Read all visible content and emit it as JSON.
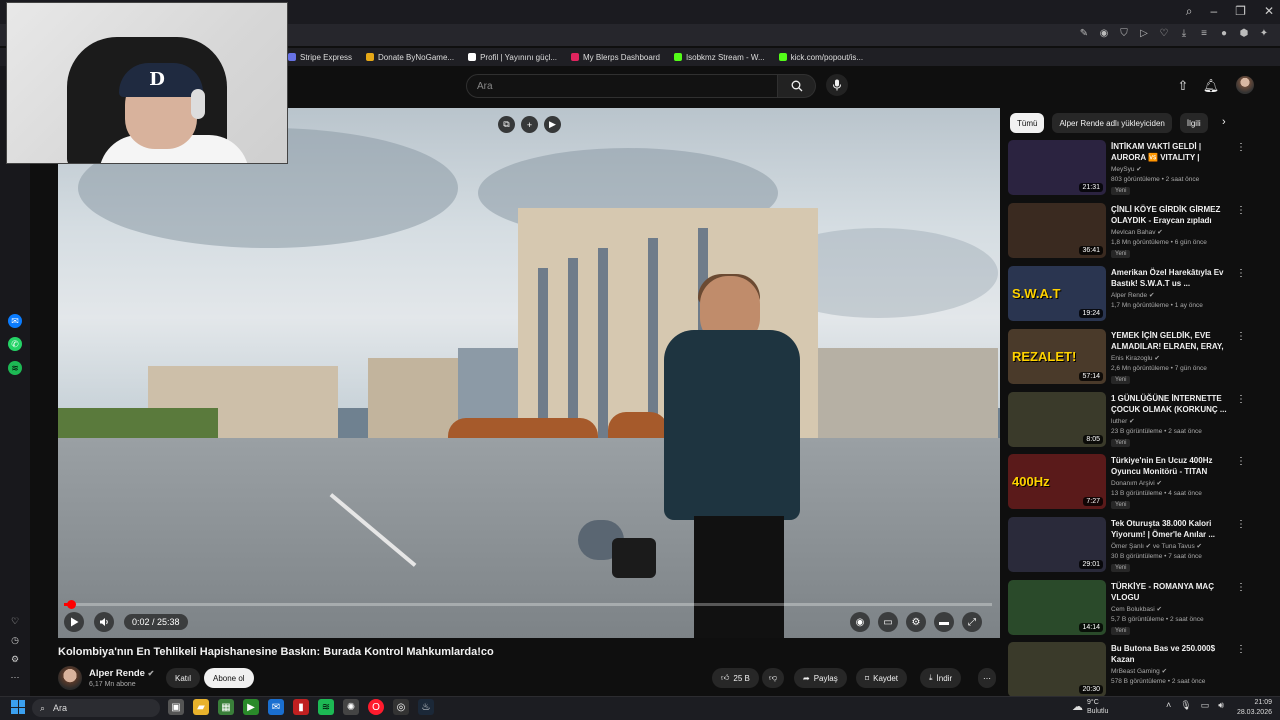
{
  "bookmarks": [
    {
      "label": "Stripe Express",
      "color": "#6772e5"
    },
    {
      "label": "Donate ByNoGame...",
      "color": "#e6a817"
    },
    {
      "label": "Profil | Yayınını güçl...",
      "color": "#ffffff"
    },
    {
      "label": "My Blerps Dashboard",
      "color": "#e0245e"
    },
    {
      "label": "Isobkmz Stream - W...",
      "color": "#53fc18"
    },
    {
      "label": "kick.com/popout/is...",
      "color": "#53fc18"
    }
  ],
  "header": {
    "search_placeholder": "Ara"
  },
  "player": {
    "time": "0:02 / 25:38",
    "progress": 0.0013
  },
  "video": {
    "title": "Kolombiya'nın En Tehlikeli Hapishanesine Baskın: Burada Kontrol Mahkumlarda!co",
    "channel": "Alper Rende",
    "subscribers": "6,17 Mn abone",
    "join_label": "Katıl",
    "subscribe_label": "Abone ol",
    "likes": "25 B",
    "share_label": "Paylaş",
    "save_label": "Kaydet",
    "download_label": "İndir"
  },
  "chips": [
    "Tümü",
    "Alper Rende adlı yükleyiciden",
    "İlgili"
  ],
  "recommendations": [
    {
      "title": "İNTİKAM VAKTİ GELDİ | AURORA 🆚 VITALITY | BLAS...",
      "channel": "MeySyu",
      "meta": "803 görüntüleme • 2 saat önce",
      "badge": "Yeni",
      "duration": "21:31",
      "thumb_color": "#2b2340"
    },
    {
      "title": "ÇİNLİ KÖYE GİRDİK GİRMEZ OLAYDIK - Eraycan zıpladı",
      "channel": "Mevlcan Bahav",
      "meta": "1,8 Mn görüntüleme • 6 gün önce",
      "badge": "Yeni",
      "duration": "36:41",
      "thumb_color": "#3a2a20"
    },
    {
      "title": "Amerikan Özel Harekâtıyla Ev Bastık! S.W.A.T us ...",
      "channel": "Alper Rende",
      "meta": "1,7 Mn görüntüleme • 1 ay önce",
      "badge": "",
      "duration": "19:24",
      "thumb_color": "#2a3550",
      "thumb_text": "S.W.A.T"
    },
    {
      "title": "YEMEK İÇİN GELDİK, EVE ALMADILAR! ELRAEN, ERAY, ...",
      "channel": "Enis Kirazoglu",
      "meta": "2,6 Mn görüntüleme • 7 gün önce",
      "badge": "Yeni",
      "duration": "57:14",
      "thumb_color": "#4a3a2a",
      "thumb_text": "REZALET!"
    },
    {
      "title": "1 GÜNLÜĞÜNE İNTERNETTE ÇOCUK OLMAK (KORKUNÇ ...",
      "channel": "luther",
      "meta": "23 B görüntüleme • 2 saat önce",
      "badge": "Yeni",
      "duration": "8:05",
      "thumb_color": "#3a3a2a"
    },
    {
      "title": "Türkiye'nin En Ucuz 400Hz Oyuncu Monitörü - TITAN",
      "channel": "Donanım Arşivi",
      "meta": "13 B görüntüleme • 4 saat önce",
      "badge": "Yeni",
      "duration": "7:27",
      "thumb_color": "#5a1a1a",
      "thumb_text": "400Hz"
    },
    {
      "title": "Tek Oturuşta 38.000 Kalori Yiyorum! | Ömer'le Anılar ...",
      "channel": "Ömer Şanlı ✔ ve Tuna Tavus",
      "meta": "30 B görüntüleme • 7 saat önce",
      "badge": "Yeni",
      "duration": "29:01",
      "thumb_color": "#2a2a3a"
    },
    {
      "title": "TÜRKİYE - ROMANYA MAÇ VLOGU",
      "channel": "Cem Bolukbasi",
      "meta": "5,7 B görüntüleme • 2 saat önce",
      "badge": "Yeni",
      "duration": "14:14",
      "thumb_color": "#2a4a2a"
    },
    {
      "title": "Bu Butona Bas ve 250.000$ Kazan",
      "channel": "MrBeast Gaming",
      "meta": "578 B görüntüleme • 2 saat önce",
      "badge": "",
      "duration": "20:30",
      "thumb_color": "#3a3a2a"
    }
  ],
  "taskbar": {
    "search_label": "Ara",
    "weather_temp": "9°C",
    "weather_text": "Bulutlu",
    "time": "21:09",
    "date": "28.03.2026"
  },
  "colors": {
    "accent_red": "#ff0000",
    "background": "#0f0f0f"
  }
}
